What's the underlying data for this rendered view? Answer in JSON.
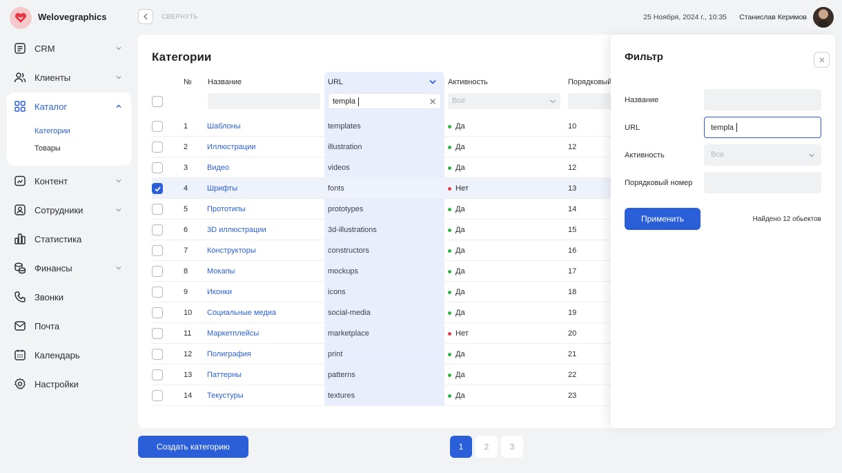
{
  "brand": {
    "name": "Welovegraphics",
    "color": "#e53945"
  },
  "topbar": {
    "collapse_label": "СВЕРНУТЬ",
    "datetime": "25 Ноября, 2024 г., 10:35",
    "user_name": "Станислав Керимов"
  },
  "sidebar": {
    "items": [
      {
        "label": "CRM",
        "icon": "document-list-icon",
        "has_chevron": true
      },
      {
        "label": "Клиенты",
        "icon": "users-icon",
        "has_chevron": true
      },
      {
        "label": "Каталог",
        "icon": "grid-icon",
        "has_chevron": true,
        "expanded": true
      },
      {
        "label": "Контент",
        "icon": "content-icon",
        "has_chevron": true
      },
      {
        "label": "Сотрудники",
        "icon": "employee-icon",
        "has_chevron": true
      },
      {
        "label": "Статистика",
        "icon": "chart-icon",
        "has_chevron": false
      },
      {
        "label": "Финансы",
        "icon": "coins-icon",
        "has_chevron": true
      },
      {
        "label": "Звонки",
        "icon": "phone-icon",
        "has_chevron": false
      },
      {
        "label": "Почта",
        "icon": "mail-icon",
        "has_chevron": false
      },
      {
        "label": "Календарь",
        "icon": "calendar-icon",
        "has_chevron": false
      },
      {
        "label": "Настройки",
        "icon": "gear-icon",
        "has_chevron": false
      }
    ],
    "catalog_sub": [
      {
        "label": "Категории",
        "active": true
      },
      {
        "label": "Товары",
        "active": false
      }
    ]
  },
  "main": {
    "title": "Категории",
    "columns": {
      "num": "№",
      "name": "Название",
      "url": "URL",
      "active": "Активность",
      "order": "Порядковый"
    },
    "filters": {
      "url_value": "templa",
      "active_value": "Все"
    },
    "rows": [
      {
        "num": "1",
        "name": "Шаблоны",
        "url": "templates",
        "active": "Да",
        "order": "10",
        "checked": false
      },
      {
        "num": "2",
        "name": "Иллюстрации",
        "url": "illustration",
        "active": "Да",
        "order": "12",
        "checked": false
      },
      {
        "num": "3",
        "name": "Видео",
        "url": "videos",
        "active": "Да",
        "order": "12",
        "checked": false
      },
      {
        "num": "4",
        "name": "Шрифты",
        "url": "fonts",
        "active": "Нет",
        "order": "13",
        "checked": true
      },
      {
        "num": "5",
        "name": "Прототипы",
        "url": "prototypes",
        "active": "Да",
        "order": "14",
        "checked": false
      },
      {
        "num": "6",
        "name": "3D иллюстрации",
        "url": "3d-illustrations",
        "active": "Да",
        "order": "15",
        "checked": false
      },
      {
        "num": "7",
        "name": "Конструкторы",
        "url": "constructors",
        "active": "Да",
        "order": "16",
        "checked": false
      },
      {
        "num": "8",
        "name": "Мокапы",
        "url": "mockups",
        "active": "Да",
        "order": "17",
        "checked": false
      },
      {
        "num": "9",
        "name": "Иконки",
        "url": "icons",
        "active": "Да",
        "order": "18",
        "checked": false
      },
      {
        "num": "10",
        "name": "Социальные медиа",
        "url": "social-media",
        "active": "Да",
        "order": "19",
        "checked": false
      },
      {
        "num": "11",
        "name": "Маркетплейсы",
        "url": "marketplace",
        "active": "Нет",
        "order": "20",
        "checked": false
      },
      {
        "num": "12",
        "name": "Полиграфия",
        "url": "print",
        "active": "Да",
        "order": "21",
        "checked": false
      },
      {
        "num": "13",
        "name": "Паттерны",
        "url": "patterns",
        "active": "Да",
        "order": "22",
        "checked": false
      },
      {
        "num": "14",
        "name": "Текустуры",
        "url": "textures",
        "active": "Да",
        "order": "23",
        "checked": false
      }
    ],
    "status_colors": {
      "yes": "#2fb344",
      "no": "#e53945"
    }
  },
  "filter_panel": {
    "title": "Фильтр",
    "fields": {
      "name_label": "Название",
      "url_label": "URL",
      "url_value": "templa",
      "active_label": "Активность",
      "active_value": "Все",
      "order_label": "Порядковый номер"
    },
    "apply_label": "Применить",
    "found_text": "Найдено 12 обьектов"
  },
  "bottom": {
    "create_label": "Создать категорию",
    "pages": [
      "1",
      "2",
      "3"
    ],
    "current_page": "1"
  }
}
